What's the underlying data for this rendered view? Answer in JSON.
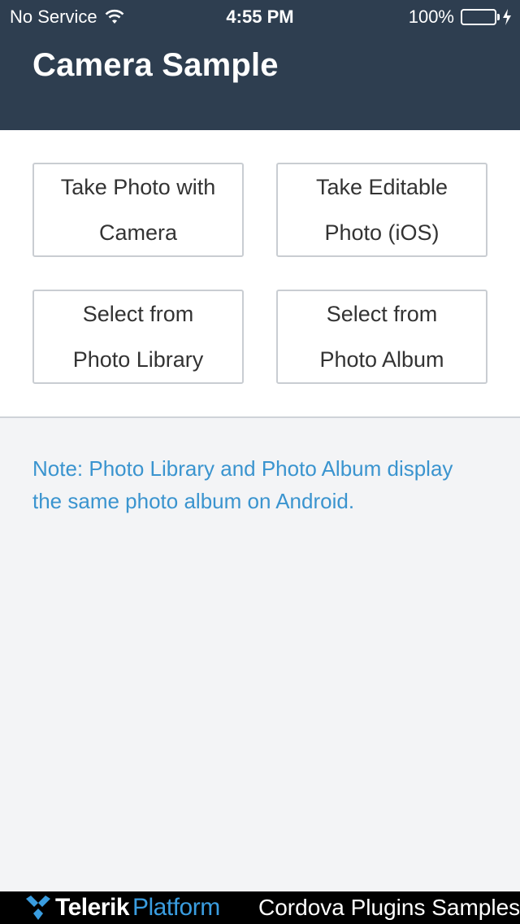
{
  "status_bar": {
    "carrier": "No Service",
    "time": "4:55 PM",
    "battery": "100%",
    "battery_level": 1.0
  },
  "header": {
    "title": "Camera Sample"
  },
  "buttons": [
    {
      "line1": "Take Photo with",
      "line2": "Camera"
    },
    {
      "line1": "Take Editable",
      "line2": "Photo (iOS)"
    },
    {
      "line1": "Select from",
      "line2": "Photo Library"
    },
    {
      "line1": "Select from",
      "line2": "Photo Album"
    }
  ],
  "note": {
    "line1": "Note: Photo Library and Photo Album display",
    "line2": "the same photo album on Android."
  },
  "footer": {
    "brand_telerik": "Telerik",
    "brand_platform": "Platform",
    "title": "Cordova Plugins Samples"
  },
  "colors": {
    "header_bg": "#2e3e50",
    "note_text": "#3a94cf",
    "battery_fill": "#4cd964",
    "platform_blue": "#3a9de0"
  },
  "icons": [
    "wifi-icon",
    "battery-icon",
    "charging-bolt-icon",
    "telerik-logo-icon"
  ]
}
